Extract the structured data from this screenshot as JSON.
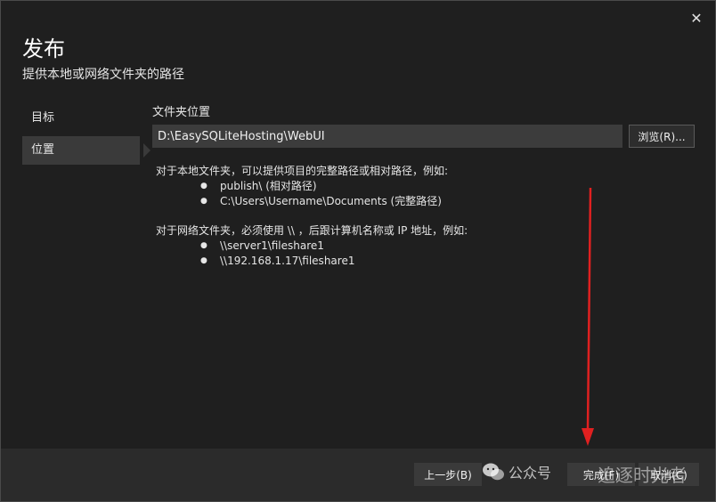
{
  "window": {
    "title": "发布",
    "subtitle": "提供本地或网络文件夹的路径",
    "close_glyph": "✕"
  },
  "nav": {
    "items": [
      {
        "label": "目标",
        "active": false
      },
      {
        "label": "位置",
        "active": true
      }
    ]
  },
  "location": {
    "field_label": "文件夹位置",
    "path_value": "D:\\EasySQLiteHosting\\WebUI",
    "browse_label": "浏览(R)..."
  },
  "help": {
    "local_intro": "对于本地文件夹，可以提供项目的完整路径或相对路径，例如:",
    "local_examples": [
      "publish\\ (相对路径)",
      "C:\\Users\\Username\\Documents (完整路径)"
    ],
    "network_intro": "对于网络文件夹，必须使用 \\\\ ，后跟计算机名称或 IP 地址，例如:",
    "network_examples": [
      "\\\\server1\\fileshare1",
      "\\\\192.168.1.17\\fileshare1"
    ]
  },
  "footer": {
    "prev_label": "上一步(B)",
    "finish_label": "完成(F)",
    "cancel_label": "取消(C)"
  },
  "watermark": {
    "text": "公众号",
    "name": "追逐时光者"
  },
  "colors": {
    "background": "#1f1f1f",
    "input": "#3c3c3c",
    "footer": "#2b2b2b",
    "annotation_arrow": "#e02020"
  },
  "icons": {
    "close": "close-icon",
    "watermark": "wechat-icon"
  }
}
